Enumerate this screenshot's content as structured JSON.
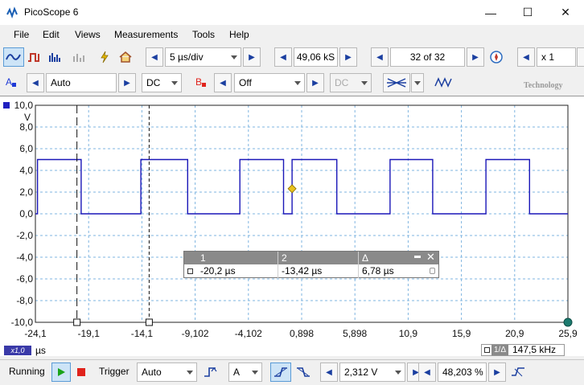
{
  "window": {
    "title": "PicoScope 6",
    "minimize": "—",
    "maximize": "☐",
    "close": "✕"
  },
  "menu": [
    "File",
    "Edit",
    "Views",
    "Measurements",
    "Tools",
    "Help"
  ],
  "toolbar": {
    "timebase": "5 µs/div",
    "samples": "49,06 kS",
    "buffer": "32 of 32",
    "zoom": "x 1"
  },
  "channels": {
    "a": {
      "label": "A",
      "range": "Auto",
      "coupling": "DC",
      "color": "#1f3ad6"
    },
    "b": {
      "label": "B",
      "range": "Off",
      "coupling": "DC",
      "color": "#e0231c"
    }
  },
  "brand_text": "Technology",
  "scope": {
    "y_unit": "V",
    "x_unit": "µs",
    "x_zoom_badge": "x1,0",
    "y_ticks": [
      "10,0",
      "8,0",
      "6,0",
      "4,0",
      "2,0",
      "0,0",
      "-2,0",
      "-4,0",
      "-6,0",
      "-8,0",
      "-10,0"
    ],
    "x_ticks": [
      "-24,1",
      "-19,1",
      "-14,1",
      "-9,102",
      "-4,102",
      "0,898",
      "5,898",
      "10,9",
      "15,9",
      "20,9",
      "25,9"
    ],
    "trace_color": "#1a17b8",
    "grid_color": "#7fb5e0",
    "frequency_label": "1/Δ",
    "frequency": "147,5 kHz",
    "trigger_marker_color": "#e8c21e"
  },
  "chart_data": {
    "type": "line",
    "title": "",
    "xlabel": "µs",
    "ylabel": "V",
    "xlim": [
      -24.1,
      25.9
    ],
    "ylim": [
      -10.0,
      10.0
    ],
    "grid": true,
    "series": [
      {
        "x": [
          -24.1,
          -23.9,
          -23.9,
          -19.8,
          -19.8,
          -15.3,
          -15.3,
          -14.2,
          -14.2,
          -9.8,
          -9.8,
          -4.9,
          -4.9,
          -0.8,
          -0.8,
          0.0,
          0.0,
          4.2,
          4.2,
          9.2,
          9.2,
          13.2,
          13.2,
          18.2,
          18.2,
          22.3,
          22.3,
          25.9
        ],
        "y": [
          0.0,
          0.0,
          5.0,
          5.0,
          0.0,
          0.0,
          0.0,
          0.0,
          5.0,
          5.0,
          0.0,
          0.0,
          5.0,
          5.0,
          0.0,
          0.0,
          5.0,
          5.0,
          0.0,
          0.0,
          5.0,
          5.0,
          0.0,
          0.0,
          5.0,
          5.0,
          0.0,
          0.0
        ]
      }
    ],
    "rulers": [
      -20.2,
      -13.42
    ]
  },
  "ruler_table": {
    "headers": [
      "1",
      "2",
      "Δ"
    ],
    "values": [
      "-20,2 µs",
      "-13,42 µs",
      "6,78 µs"
    ]
  },
  "status": {
    "run_state": "Running",
    "trigger_label": "Trigger",
    "trigger_mode": "Auto",
    "trigger_channel": "A",
    "threshold": "2,312 V",
    "pretrigger": "48,203 %"
  }
}
